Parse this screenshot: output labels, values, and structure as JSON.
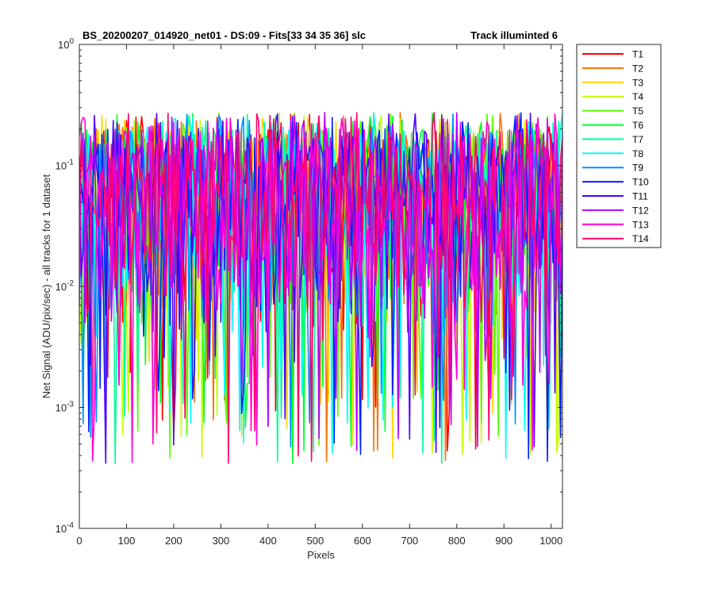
{
  "chart_data": {
    "type": "line",
    "title_left": "BS_20200207_014920_net01 - DS:09 - Fits[33  34  35  36]   slc",
    "title_right": "Track illuminted 6",
    "xlabel": "Pixels",
    "ylabel": "Net Signal (ADU/pix/sec) - all tracks for 1 dataset",
    "xlim": [
      0,
      1024
    ],
    "ylim": [
      0.0001,
      1
    ],
    "yscale": "log",
    "x_ticks": [
      0,
      100,
      200,
      300,
      400,
      500,
      600,
      700,
      800,
      900,
      1000
    ],
    "y_ticks": [
      {
        "value": 0.0001,
        "base": "10",
        "exp": "-4"
      },
      {
        "value": 0.001,
        "base": "10",
        "exp": "-3"
      },
      {
        "value": 0.01,
        "base": "10",
        "exp": "-2"
      },
      {
        "value": 0.1,
        "base": "10",
        "exp": "-1"
      },
      {
        "value": 1,
        "base": "10",
        "exp": "0"
      }
    ],
    "grid": false,
    "legend_position": "outside-top-right",
    "series": [
      {
        "name": "T1",
        "color": "#ff0000"
      },
      {
        "name": "T2",
        "color": "#ff6e00"
      },
      {
        "name": "T3",
        "color": "#ffd700"
      },
      {
        "name": "T4",
        "color": "#c2ff00"
      },
      {
        "name": "T5",
        "color": "#54ff00"
      },
      {
        "name": "T6",
        "color": "#00ff2a"
      },
      {
        "name": "T7",
        "color": "#00ff98"
      },
      {
        "name": "T8",
        "color": "#00fcff"
      },
      {
        "name": "T9",
        "color": "#008fff"
      },
      {
        "name": "T10",
        "color": "#0021ff"
      },
      {
        "name": "T11",
        "color": "#4c00ff"
      },
      {
        "name": "T12",
        "color": "#ba00ff"
      },
      {
        "name": "T13",
        "color": "#ff00d7"
      },
      {
        "name": "T14",
        "color": "#ff0069"
      }
    ],
    "value_model": {
      "typical_range": [
        0.003,
        0.2
      ],
      "peak_max": 0.34,
      "floor": 0.00034,
      "step_pixels": 4
    }
  }
}
